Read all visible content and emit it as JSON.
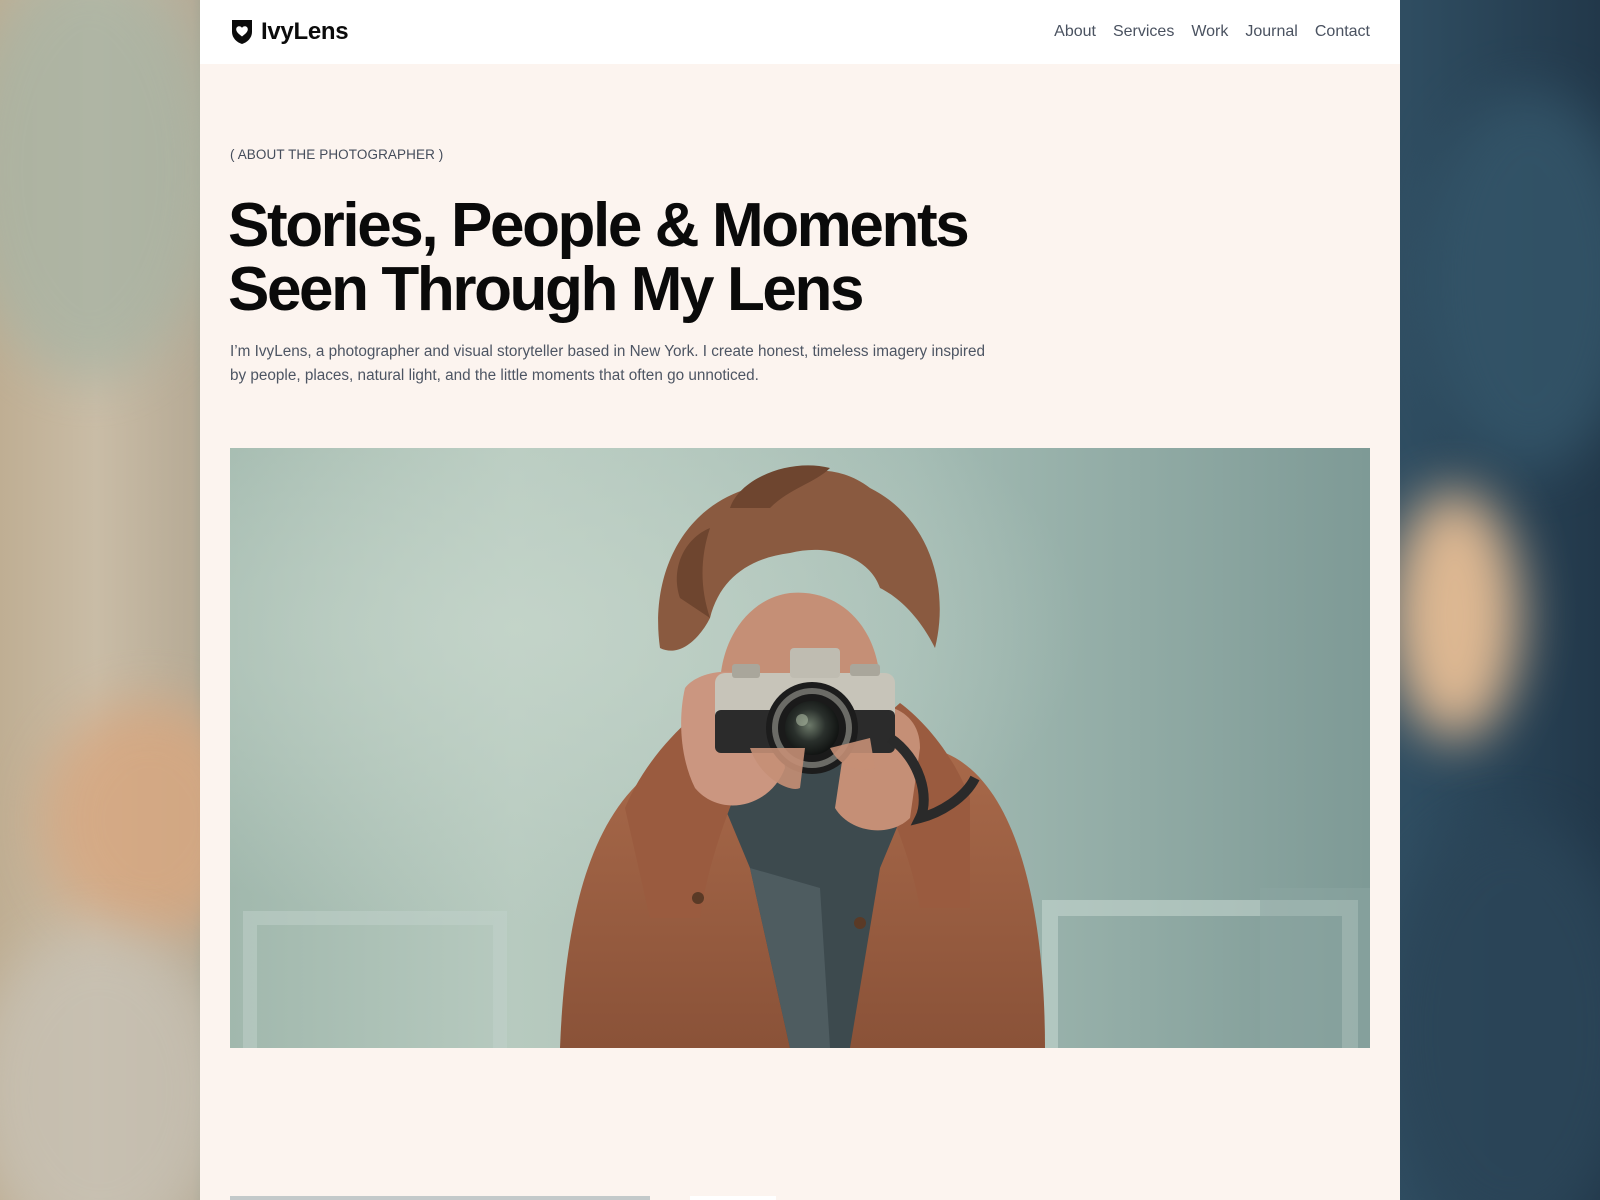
{
  "brand": {
    "name": "IvyLens",
    "logo_icon": "shield-heart-icon"
  },
  "nav": {
    "items": [
      {
        "label": "About"
      },
      {
        "label": "Services"
      },
      {
        "label": "Work"
      },
      {
        "label": "Journal"
      },
      {
        "label": "Contact"
      }
    ]
  },
  "hero": {
    "eyebrow": "( ABOUT THE PHOTOGRAPHER )",
    "title_line1": "Stories, People & Moments",
    "title_line2": "Seen Through My Lens",
    "intro_line1": "I’m IvyLens, a photographer and visual storyteller based in New York. I create honest, timeless imagery inspired",
    "intro_line2": "by people, places, natural light, and the little moments that often go unnoticed.",
    "image_subject": "photographer-with-camera-photo"
  },
  "colors": {
    "page_background": "#fcf4ef",
    "navbar_background": "#ffffff",
    "heading": "#0a0a0a",
    "body_text": "#4d5563",
    "nav_text": "#4a5260"
  }
}
